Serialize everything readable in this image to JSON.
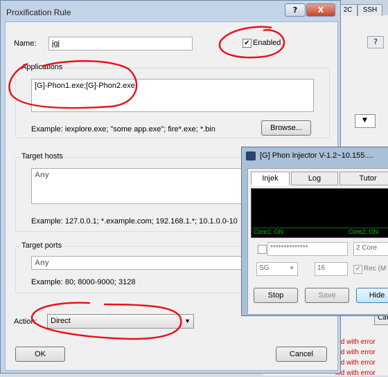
{
  "background_window": {
    "tabs": [
      "2C",
      "SSH"
    ],
    "help_label": "?",
    "cancel_partial": "Canc",
    "error_lines": [
      "led with error",
      "led with error",
      "led with error",
      "led with error"
    ]
  },
  "dialog": {
    "title": "Proxification Rule",
    "help_label": "?",
    "close_label": "X",
    "name_label": "Name:",
    "name_value": "jgj",
    "enabled_label": "Enabled",
    "enabled_checked": true,
    "applications": {
      "group_label": "Applications",
      "value": "[G]-Phon1.exe;[G]-Phon2.exe;",
      "example": "Example: iexplore.exe; \"some app.exe\"; fire*.exe; *.bin",
      "browse_label": "Browse..."
    },
    "target_hosts": {
      "group_label": "Target hosts",
      "value": "Any",
      "example": "Example: 127.0.0.1; *.example.com; 192.168.1.*; 10.1.0.0-10"
    },
    "target_ports": {
      "group_label": "Target ports",
      "value": "Any",
      "example": "Example: 80; 8000-9000; 3128"
    },
    "action_label": "Action:",
    "action_value": "Direct",
    "ok_label": "OK",
    "cancel_label": "Cancel"
  },
  "injector": {
    "title": "[G] Phon Injector V-1.2~10.155....",
    "tabs": [
      "Injek",
      "Log",
      "Tutor"
    ],
    "core1": "Core1: ON",
    "core2": "Core2: ON",
    "password_mask": "**************",
    "core_select": "2 Core",
    "region_select": "SG",
    "number_value": "16",
    "rec_label": "Rec (M",
    "stop_label": "Stop",
    "save_label": "Save",
    "hide_label": "Hide"
  },
  "colors": {
    "annotation": "#e8121e",
    "console_text": "#00c800"
  }
}
